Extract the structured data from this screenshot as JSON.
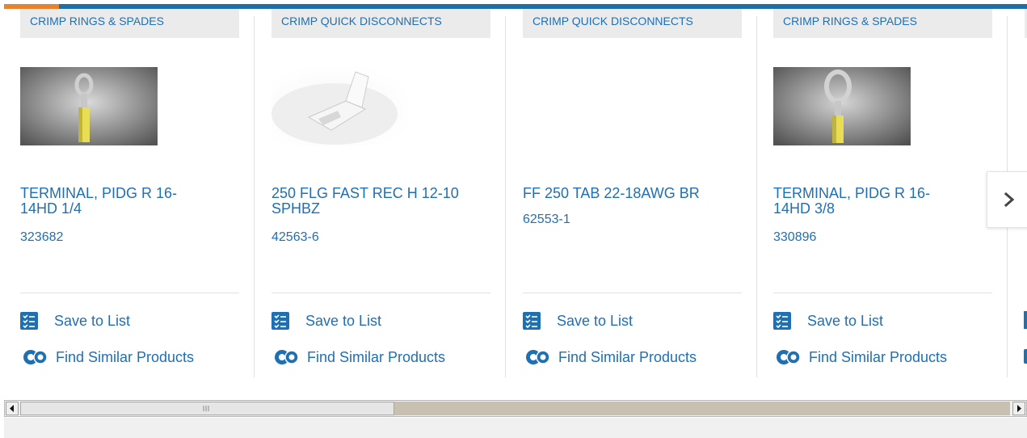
{
  "colors": {
    "brand": "#1f6fb3",
    "top_bar": "#1e6ea7",
    "top_accent": "#e7822f"
  },
  "cards": [
    {
      "category": "CRIMP RINGS & SPADES",
      "title": "TERMINAL, PIDG R 16-14HD 1/4",
      "part_number": "323682",
      "image": "ring-terminal-photo",
      "save_label": "Save to List",
      "find_label": "Find Similar Products"
    },
    {
      "category": "CRIMP QUICK DISCONNECTS",
      "title": "250 FLG FAST REC H 12-10 SPHBZ",
      "part_number": "42563-6",
      "image": "flag-receptacle-photo",
      "save_label": "Save to List",
      "find_label": "Find Similar Products"
    },
    {
      "category": "CRIMP QUICK DISCONNECTS",
      "title": "FF 250 TAB 22-18AWG BR",
      "part_number": "62553-1",
      "image": "",
      "save_label": "Save to List",
      "find_label": "Find Similar Products"
    },
    {
      "category": "CRIMP RINGS & SPADES",
      "title": "TERMINAL, PIDG R 16-14HD 3/8",
      "part_number": "330896",
      "image": "ring-terminal-photo",
      "save_label": "Save to List",
      "find_label": "Find Similar Products"
    }
  ],
  "carousel": {
    "next_icon": "chevron-right-icon"
  },
  "icons": {
    "save": "list-check-icon",
    "find": "gears-icon"
  }
}
